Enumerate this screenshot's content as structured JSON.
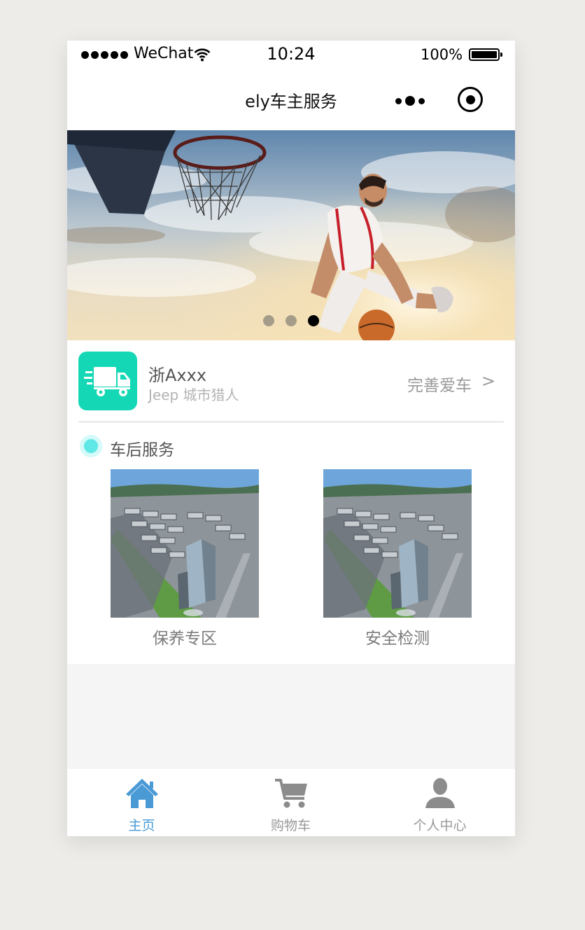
{
  "status_bar": {
    "carrier": "WeChat",
    "time": "10:24",
    "battery": "100%",
    "signal_icon": "signal-dots-icon",
    "wifi_icon": "wifi-icon",
    "battery_icon": "battery-icon"
  },
  "nav": {
    "title": "ely车主服务",
    "more_icon": "more-dots-icon",
    "close_icon": "record-close-icon"
  },
  "banner": {
    "image": "basketball-player-dunk-photo",
    "slide_count": 3,
    "active_slide": 3
  },
  "car": {
    "icon": "delivery-truck-icon",
    "plate": "浙Axxx",
    "model": "Jeep 城市猎人",
    "action_label": "完善爱车",
    "action_chevron": ">"
  },
  "service": {
    "title": "车后服务",
    "items": [
      {
        "label": "保养专区",
        "image": "aerial-city-building-photo"
      },
      {
        "label": "安全检测",
        "image": "aerial-city-building-photo"
      }
    ]
  },
  "tabbar": {
    "items": [
      {
        "label": "主页",
        "icon": "home-icon",
        "active": true
      },
      {
        "label": "购物车",
        "icon": "shopping-cart-icon",
        "active": false
      },
      {
        "label": "个人中心",
        "icon": "user-icon",
        "active": false
      }
    ]
  },
  "colors": {
    "accent": "#4a9ad6",
    "car_icon_bg": "#14d8b5",
    "service_dot": "#5fe8e6",
    "page_bg": "#f5f5f6"
  }
}
